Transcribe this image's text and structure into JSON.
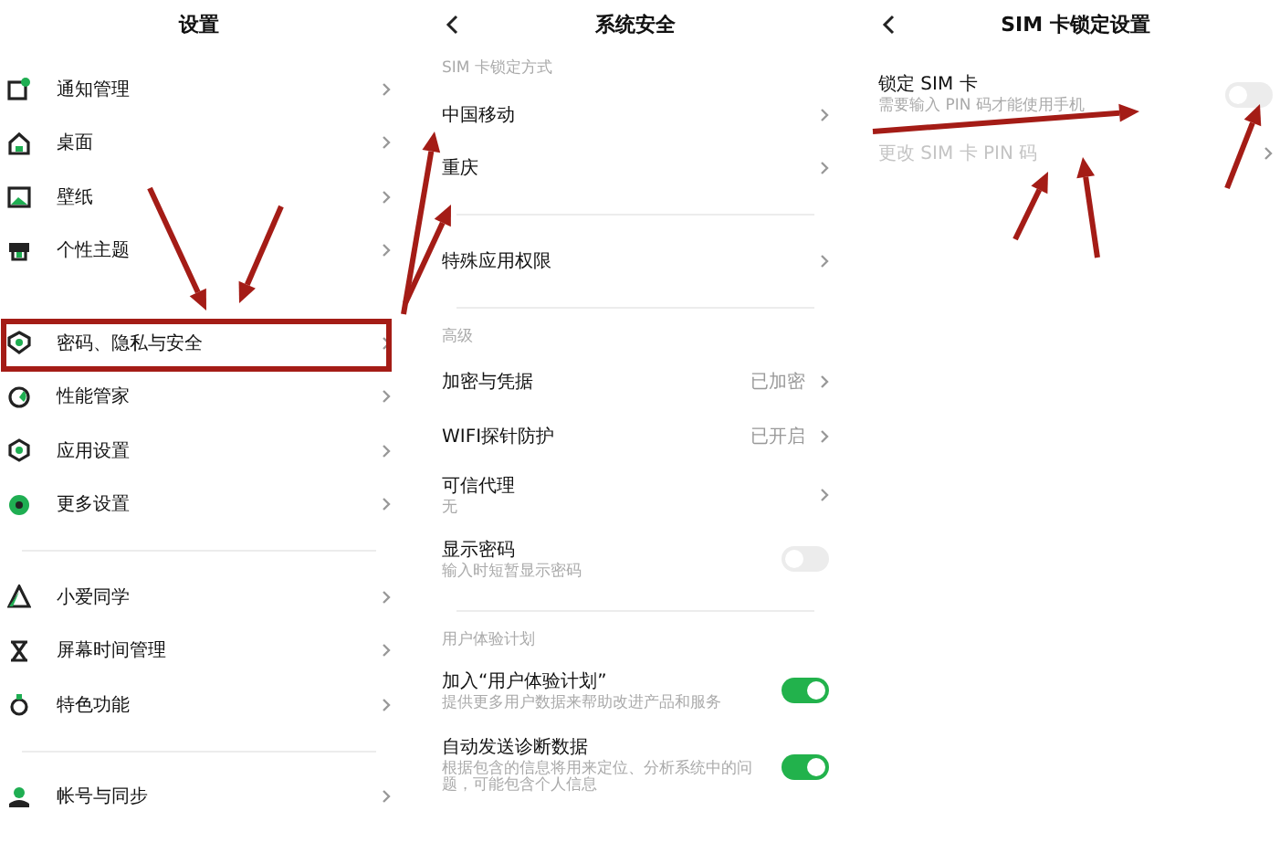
{
  "panels": [
    {
      "title": "设置",
      "groups": [
        {
          "items": [
            {
              "kind": "link",
              "title": "通知管理"
            },
            {
              "kind": "link",
              "title": "桌面"
            },
            {
              "kind": "link",
              "title": "壁纸"
            },
            {
              "kind": "link",
              "title": "个性主题"
            }
          ]
        },
        {
          "items": [
            {
              "kind": "link",
              "title": "密码、隐私与安全"
            },
            {
              "kind": "link",
              "title": "性能管家"
            },
            {
              "kind": "link",
              "title": "应用设置"
            },
            {
              "kind": "link",
              "title": "更多设置"
            }
          ]
        },
        {
          "items": [
            {
              "kind": "link",
              "title": "小爱同学"
            },
            {
              "kind": "link",
              "title": "屏幕时间管理"
            },
            {
              "kind": "link",
              "title": "特色功能"
            }
          ]
        },
        {
          "items": [
            {
              "kind": "link",
              "title": "帐号与同步"
            }
          ]
        }
      ]
    },
    {
      "title": "系统安全",
      "back": true,
      "groups": [
        {
          "label": "SIM 卡锁定方式",
          "items": [
            {
              "kind": "link",
              "title": "中国移动"
            },
            {
              "kind": "link",
              "title": "重庆"
            }
          ]
        },
        {
          "items": [
            {
              "kind": "link",
              "title": "特殊应用权限"
            }
          ]
        },
        {
          "label": "高级",
          "items": [
            {
              "kind": "link",
              "title": "加密与凭据",
              "value": "已加密"
            },
            {
              "kind": "link",
              "title": "WIFI探针防护",
              "value": "已开启"
            },
            {
              "kind": "link",
              "title": "可信代理",
              "subtitle": "无"
            },
            {
              "kind": "toggle",
              "title": "显示密码",
              "subtitle": "输入时短暂显示密码",
              "on": false
            }
          ]
        },
        {
          "label": "用户体验计划",
          "items": [
            {
              "kind": "toggle",
              "title": "加入“用户体验计划”",
              "subtitle": "提供更多用户数据来帮助改进产品和服务",
              "on": true
            },
            {
              "kind": "toggle",
              "title": "自动发送诊断数据",
              "subtitle": "根据包含的信息将用来定位、分析系统中的问题，可能包含个人信息",
              "on": true
            }
          ]
        }
      ]
    },
    {
      "title": "SIM 卡锁定设置",
      "back": true,
      "groups": [
        {
          "items": [
            {
              "kind": "toggle",
              "title": "锁定 SIM 卡",
              "subtitle": "需要输入 PIN 码才能使用手机",
              "on": false,
              "disabled": false
            },
            {
              "kind": "link",
              "title": "更改 SIM 卡 PIN 码",
              "disabled": true
            }
          ]
        }
      ]
    }
  ]
}
